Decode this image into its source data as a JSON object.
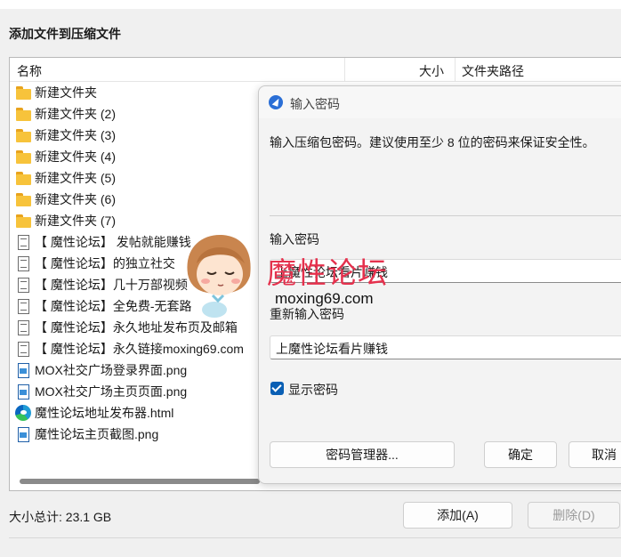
{
  "window": {
    "title": "添加文件到压缩文件"
  },
  "file_list": {
    "columns": {
      "name": "名称",
      "size": "大小",
      "path": "文件夹路径"
    },
    "items": [
      {
        "name": "新建文件夹",
        "icon": "folder-icon"
      },
      {
        "name": "新建文件夹 (2)",
        "icon": "folder-icon"
      },
      {
        "name": "新建文件夹 (3)",
        "icon": "folder-icon"
      },
      {
        "name": "新建文件夹 (4)",
        "icon": "folder-icon"
      },
      {
        "name": "新建文件夹 (5)",
        "icon": "folder-icon"
      },
      {
        "name": "新建文件夹 (6)",
        "icon": "folder-icon"
      },
      {
        "name": "新建文件夹 (7)",
        "icon": "folder-icon"
      },
      {
        "name": "【 魔性论坛】 发帖就能赚钱",
        "icon": "document-icon"
      },
      {
        "name": "【 魔性论坛】的独立社交",
        "icon": "document-icon"
      },
      {
        "name": "【 魔性论坛】几十万部视频",
        "icon": "document-icon"
      },
      {
        "name": "【 魔性论坛】全免费-无套路",
        "icon": "document-icon"
      },
      {
        "name": "【 魔性论坛】永久地址发布页及邮箱",
        "icon": "document-icon"
      },
      {
        "name": "【 魔性论坛】永久链接moxing69.com",
        "icon": "document-icon"
      },
      {
        "name": "MOX社交广场登录界面.png",
        "icon": "image-file-icon"
      },
      {
        "name": "MOX社交广场主页页面.png",
        "icon": "image-file-icon"
      },
      {
        "name": "魔性论坛地址发布器.html",
        "icon": "edge-browser-icon"
      },
      {
        "name": "魔性论坛主页截图.png",
        "icon": "image-file-icon"
      }
    ]
  },
  "footer": {
    "total_size": "大小总计: 23.1 GB",
    "add_button": "添加(A)",
    "delete_button": "删除(D)"
  },
  "password_dialog": {
    "title": "输入密码",
    "description": "输入压缩包密码。建议使用至少 8 位的密码来保证安全性。",
    "password_label": "输入密码",
    "password_value": "上魔性论坛看片赚钱",
    "confirm_label": "重新输入密码",
    "confirm_value": "上魔性论坛看片赚钱",
    "show_password_label": "显示密码",
    "show_password_checked": true,
    "password_manager_button": "密码管理器...",
    "ok_button": "确定",
    "cancel_button": "取消"
  },
  "watermark": {
    "text": "魔性论坛",
    "url": "moxing69.com",
    "color": "#e5314d"
  },
  "accent_color": "#0a5fb4"
}
